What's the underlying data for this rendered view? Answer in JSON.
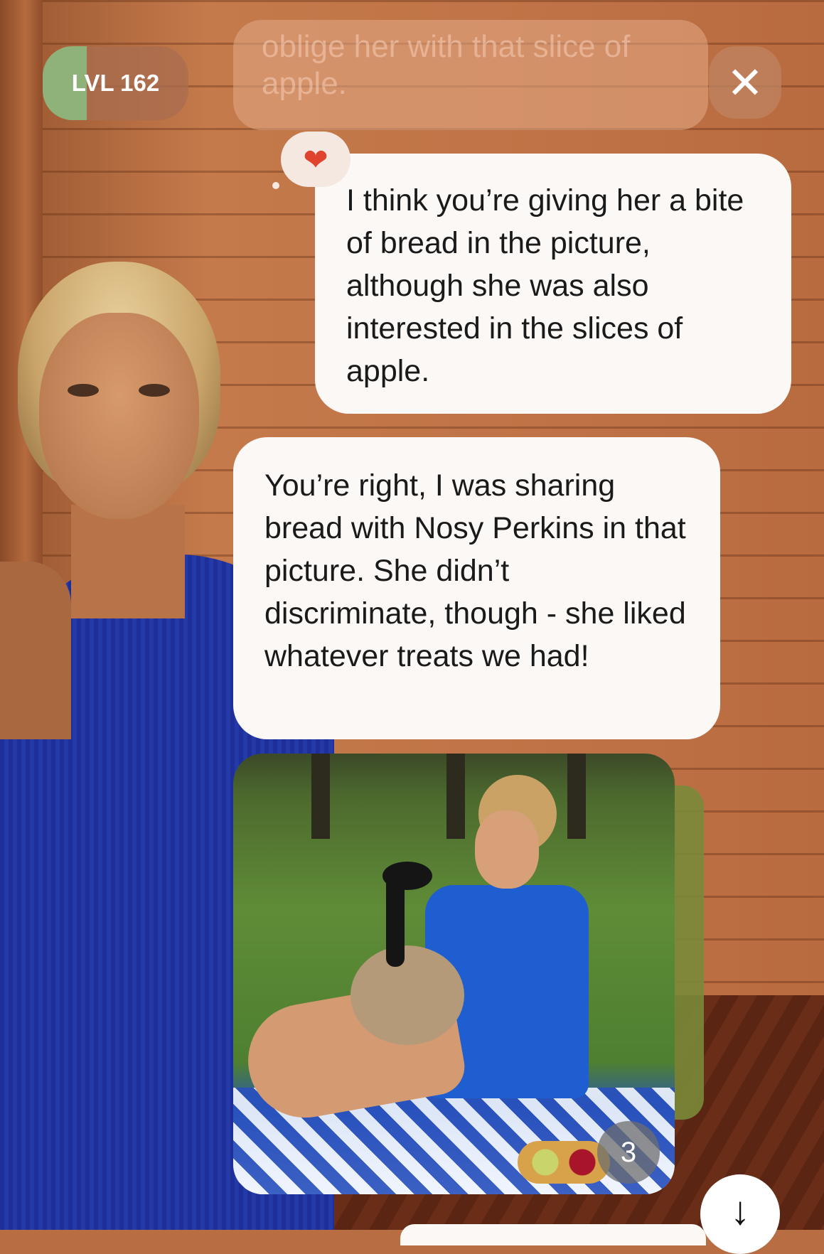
{
  "header": {
    "level_label": "LVL 162",
    "level_progress": 0.3,
    "close_symbol": "✕"
  },
  "previous_message_fragment": "oblige her with that slice of apple.",
  "reaction": {
    "icon": "heart-icon",
    "glyph": "❤"
  },
  "messages": [
    {
      "role": "user",
      "text": "I think you’re giving her a bite of bread in the picture, although she was also interested in the slices of apple."
    },
    {
      "role": "companion",
      "text": "You’re right, I was sharing bread with Nosy Perkins in that picture. She didn’t discriminate, though - she liked whatever treats we had!"
    }
  ],
  "photo": {
    "count": "3"
  },
  "scroll_button": {
    "glyph": "↓"
  },
  "colors": {
    "bubble": "#fbf8f6",
    "level_fill": "#8fb27a",
    "heart": "#e0432e",
    "wall": "#c07447"
  }
}
